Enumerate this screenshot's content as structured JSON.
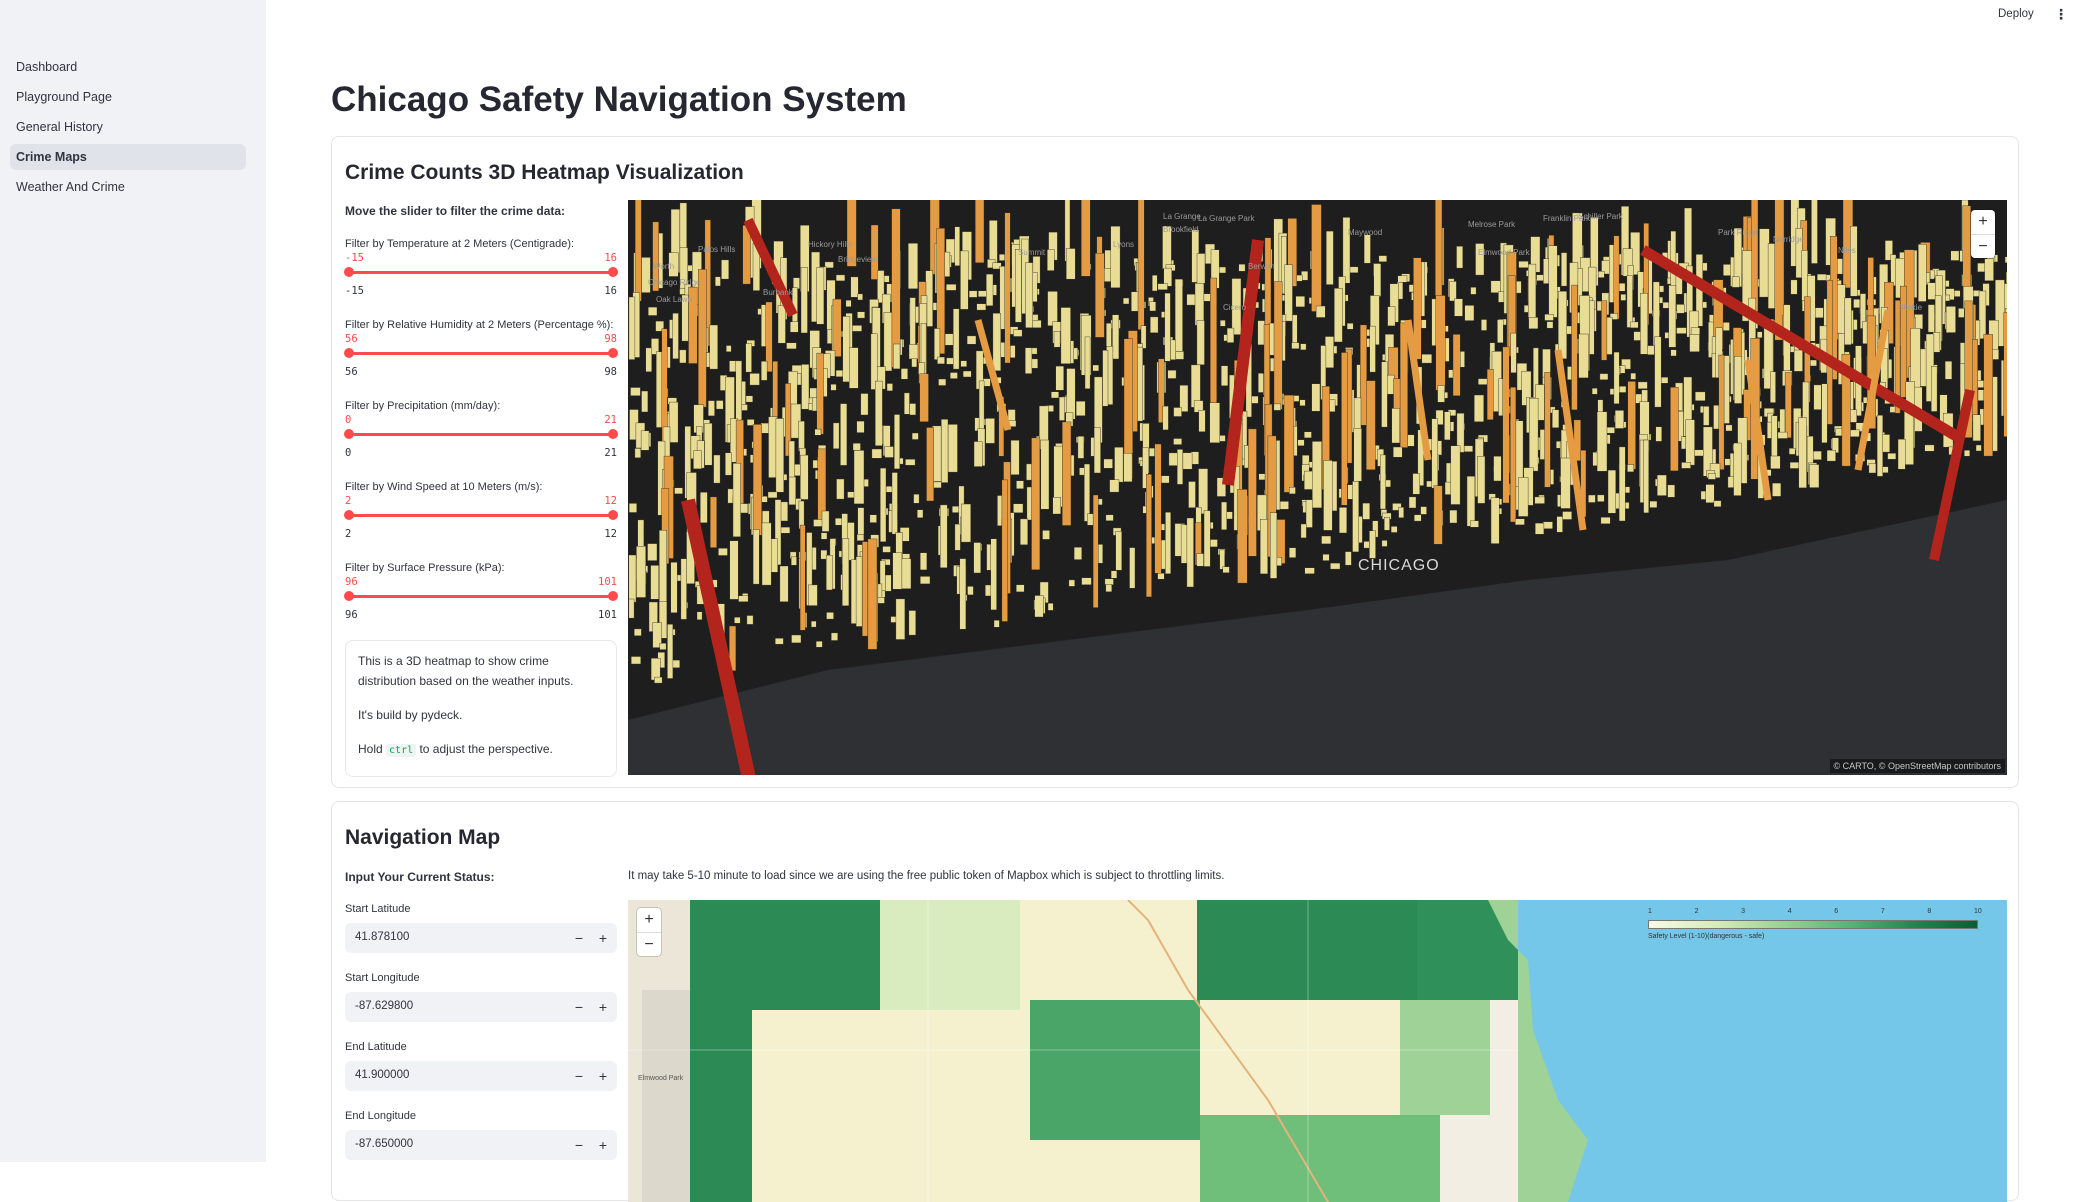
{
  "topbar": {
    "deploy_label": "Deploy",
    "menu_icon": "kebab-menu-icon"
  },
  "sidebar": {
    "items": [
      {
        "label": "Dashboard",
        "active": false
      },
      {
        "label": "Playground Page",
        "active": false
      },
      {
        "label": "General History",
        "active": false
      },
      {
        "label": "Crime Maps",
        "active": true
      },
      {
        "label": "Weather And Crime",
        "active": false
      }
    ]
  },
  "page": {
    "title": "Chicago Safety Navigation System"
  },
  "heatmap_section": {
    "title": "Crime Counts 3D Heatmap Visualization",
    "filter_heading": "Move the slider to filter the crime data:",
    "sliders": [
      {
        "label": "Filter by Temperature at 2 Meters (Centigrade):",
        "low": "-15",
        "high": "16",
        "min": "-15",
        "max": "16"
      },
      {
        "label": "Filter by Relative Humidity at 2 Meters (Percentage %):",
        "low": "56",
        "high": "98",
        "min": "56",
        "max": "98"
      },
      {
        "label": "Filter by Precipitation (mm/day):",
        "low": "0",
        "high": "21",
        "min": "0",
        "max": "21"
      },
      {
        "label": "Filter by Wind Speed at 10 Meters (m/s):",
        "low": "2",
        "high": "12",
        "min": "2",
        "max": "12"
      },
      {
        "label": "Filter by Surface Pressure (kPa):",
        "low": "96",
        "high": "101",
        "min": "96",
        "max": "101"
      }
    ],
    "info": {
      "line1": "This is a 3D heatmap to show crime distribution based on the weather inputs.",
      "line2": "It's build by pydeck.",
      "line3_pre": "Hold",
      "line3_code": "ctrl",
      "line3_post": "to adjust the perspective."
    },
    "map": {
      "zoom_in": "+",
      "zoom_out": "−",
      "attribution": "© CARTO, © OpenStreetMap contributors",
      "city_label": "CHICAGO",
      "place_labels": [
        "Palos Hills",
        "Hickory Hills",
        "Worth",
        "Chicago Ridge",
        "Oak Lawn",
        "Burbank",
        "Bridgeview",
        "Summit",
        "Lyons",
        "Brookfield",
        "La Grange",
        "La Grange Park",
        "Berwyn",
        "Cicero",
        "Maywood",
        "Melrose Park",
        "Franklin Park",
        "Schiller Park",
        "Park Ridge",
        "Norridge",
        "Niles",
        "Skokie",
        "Elmwood Park"
      ],
      "colors": {
        "background": "#1e1e1e",
        "low": "#e9dd95",
        "mid": "#e49b42",
        "high": "#b3241c",
        "water": "#2f3033"
      }
    }
  },
  "navigation_section": {
    "title": "Navigation Map",
    "status_heading": "Input Your Current Status:",
    "notice": "It may take 5-10 minute to load since we are using the free public token of Mapbox which is subject to throttling limits.",
    "fields": [
      {
        "label": "Start Latitude",
        "value": "41.878100"
      },
      {
        "label": "Start Longitude",
        "value": "-87.629800"
      },
      {
        "label": "End Latitude",
        "value": "41.900000"
      },
      {
        "label": "End Longitude",
        "value": "-87.650000"
      }
    ],
    "stepper": {
      "minus": "−",
      "plus": "+"
    },
    "map": {
      "zoom_in": "+",
      "zoom_out": "−",
      "legend_ticks": [
        "1",
        "2",
        "3",
        "4",
        "6",
        "7",
        "8",
        "10"
      ],
      "legend_caption": "Safety Level (1-10)(dangerous - safe)",
      "side_labels": [
        "Elmwood Park"
      ],
      "colors": {
        "lake": "#74c7e8",
        "safe": "#2c8a55",
        "mid": "#6fbf7a",
        "light": "#d9ecc0",
        "pale": "#f5f1cf"
      }
    }
  }
}
